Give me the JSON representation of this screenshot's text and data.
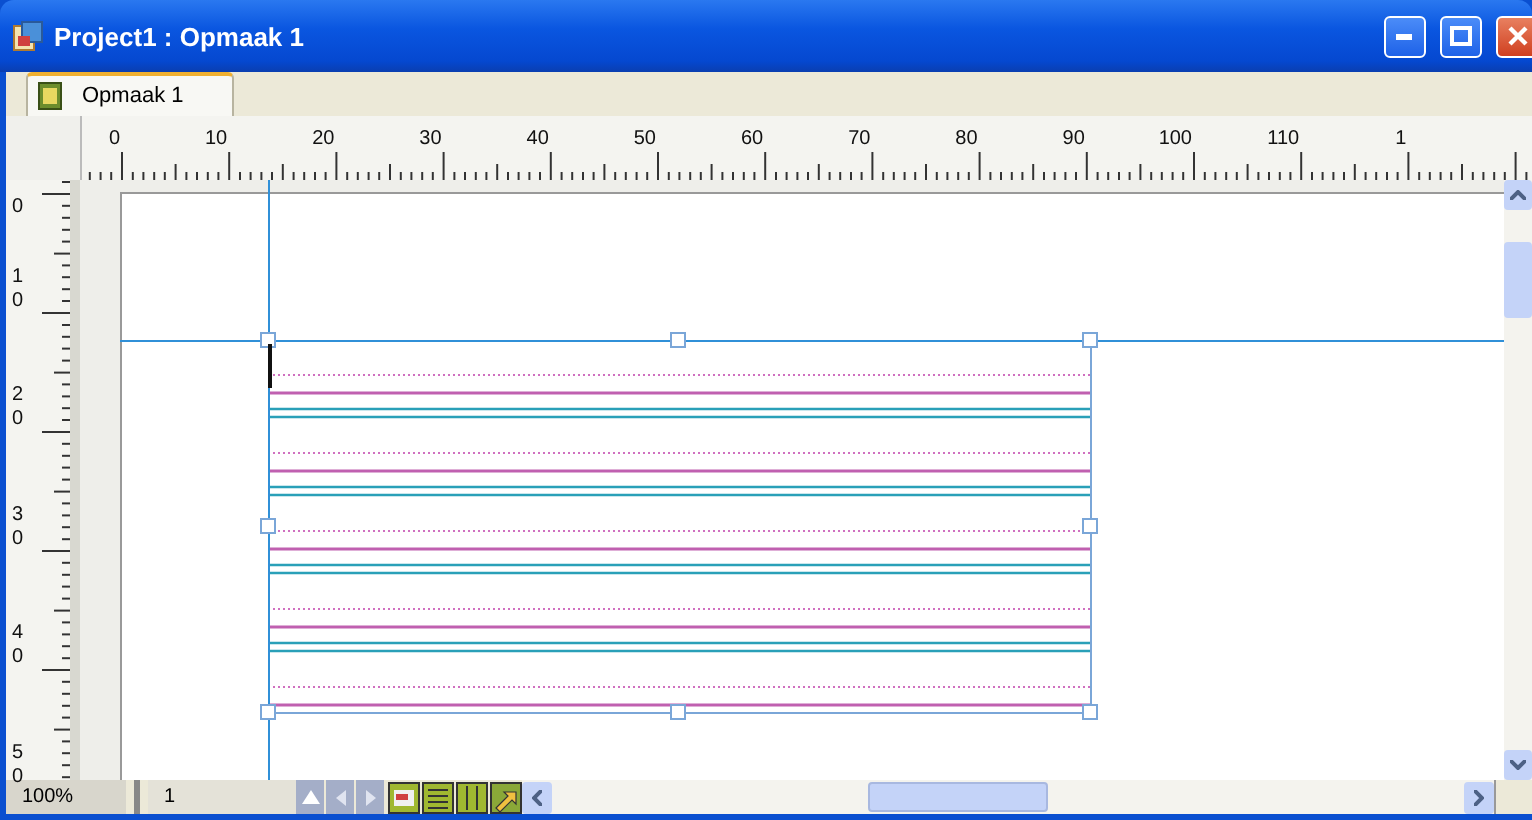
{
  "window": {
    "title": "Project1 : Opmaak 1"
  },
  "tabs": [
    {
      "label": "Opmaak 1",
      "selected": true
    }
  ],
  "ruler_horizontal": {
    "labels": [
      "0",
      "10",
      "20",
      "30",
      "40",
      "50",
      "60",
      "70",
      "80",
      "90",
      "100",
      "110",
      "1"
    ]
  },
  "ruler_vertical": {
    "labels": [
      "0",
      "10",
      "20",
      "30",
      "40",
      "50"
    ]
  },
  "text_frame": {
    "selected": true
  },
  "status_bar": {
    "zoom": "100%",
    "page": "1"
  }
}
